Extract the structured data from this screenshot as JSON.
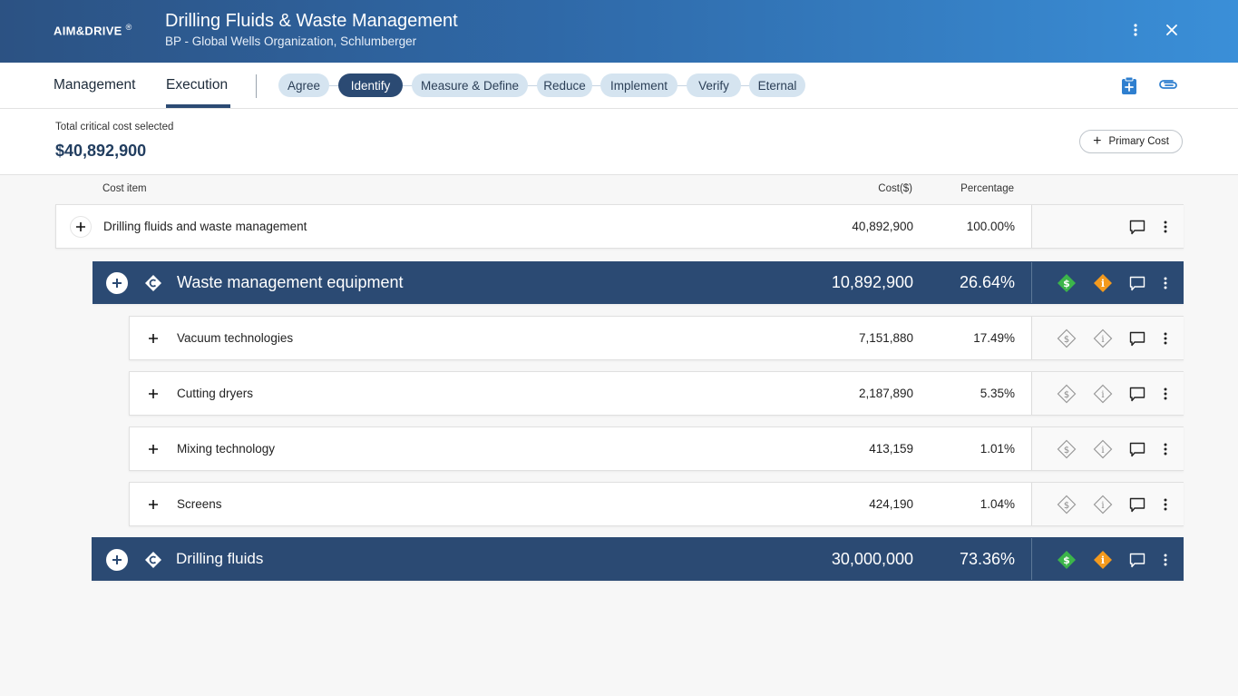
{
  "header": {
    "logo": "AIM&DRIVE",
    "logo_mark": "®",
    "title": "Drilling Fluids & Waste Management",
    "subtitle": "BP - Global Wells Organization, Schlumberger"
  },
  "nav": {
    "tabs": [
      {
        "label": "Management"
      },
      {
        "label": "Execution"
      }
    ],
    "active_tab": "Execution",
    "phases": [
      {
        "label": "Agree"
      },
      {
        "label": "Identify"
      },
      {
        "label": "Measure & Define"
      },
      {
        "label": "Reduce"
      },
      {
        "label": "Implement"
      },
      {
        "label": "Verify"
      },
      {
        "label": "Eternal"
      }
    ],
    "active_phase": "Identify"
  },
  "summary": {
    "label": "Total critical cost selected",
    "value": "$40,892,900",
    "primary_cost_button": "Primary Cost"
  },
  "table": {
    "headers": {
      "item": "Cost item",
      "cost": "Cost($)",
      "percentage": "Percentage"
    },
    "rows": [
      {
        "name": "Drilling fluids and waste management",
        "cost": "40,892,900",
        "percentage": "100.00%"
      },
      {
        "name": "Waste management equipment",
        "cost": "10,892,900",
        "percentage": "26.64%"
      },
      {
        "name": "Vacuum technologies",
        "cost": "7,151,880",
        "percentage": "17.49%"
      },
      {
        "name": "Cutting dryers",
        "cost": "2,187,890",
        "percentage": "5.35%"
      },
      {
        "name": "Mixing technology",
        "cost": "413,159",
        "percentage": "1.01%"
      },
      {
        "name": "Screens",
        "cost": "424,190",
        "percentage": "1.04%"
      },
      {
        "name": "Drilling fluids",
        "cost": "30,000,000",
        "percentage": "73.36%"
      }
    ]
  },
  "colors": {
    "accent": "#2b4a73",
    "cost_flag": "#3cb54a",
    "info_flag": "#f39a1e"
  }
}
